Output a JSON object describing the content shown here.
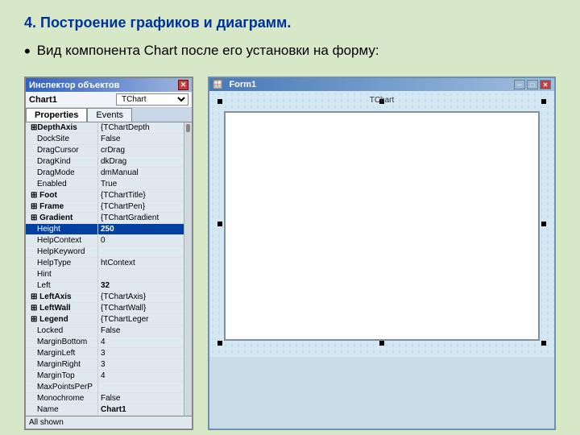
{
  "slide": {
    "title": "4.   Построение графиков и диаграмм.",
    "bullet": "Вид компонента Chart после его установки на форму:"
  },
  "inspector": {
    "title": "Инспектор объектов",
    "close_symbol": "✕",
    "object_name": "Chart1",
    "object_type": "TChart",
    "tabs": [
      "Properties",
      "Events"
    ],
    "active_tab": "Properties",
    "properties": [
      {
        "name": "⊞DepthAxis",
        "value": "{TChartDepth",
        "indent": false,
        "bold_name": true,
        "bold_value": false,
        "group": false,
        "selected": false
      },
      {
        "name": "DockSite",
        "value": "False",
        "indent": true,
        "bold_name": false,
        "bold_value": false,
        "group": false,
        "selected": false
      },
      {
        "name": "DragCursor",
        "value": "crDrag",
        "indent": true,
        "bold_name": false,
        "bold_value": false,
        "group": false,
        "selected": false
      },
      {
        "name": "DragKind",
        "value": "dkDrag",
        "indent": true,
        "bold_name": false,
        "bold_value": false,
        "group": false,
        "selected": false
      },
      {
        "name": "DragMode",
        "value": "dmManual",
        "indent": true,
        "bold_name": false,
        "bold_value": false,
        "group": false,
        "selected": false
      },
      {
        "name": "Enabled",
        "value": "True",
        "indent": true,
        "bold_name": false,
        "bold_value": false,
        "group": false,
        "selected": false
      },
      {
        "name": "⊞ Foot",
        "value": "{TChartTitle}",
        "indent": false,
        "bold_name": true,
        "bold_value": false,
        "group": false,
        "selected": false
      },
      {
        "name": "⊞ Frame",
        "value": "{TChartPen}",
        "indent": false,
        "bold_name": true,
        "bold_value": false,
        "group": false,
        "selected": false
      },
      {
        "name": "⊞ Gradient",
        "value": "{TChartGradient",
        "indent": false,
        "bold_name": true,
        "bold_value": false,
        "group": false,
        "selected": false
      },
      {
        "name": "Height",
        "value": "250",
        "indent": true,
        "bold_name": false,
        "bold_value": true,
        "group": false,
        "selected": true
      },
      {
        "name": "HelpContext",
        "value": "0",
        "indent": true,
        "bold_name": false,
        "bold_value": false,
        "group": false,
        "selected": false
      },
      {
        "name": "HelpKeyword",
        "value": "",
        "indent": true,
        "bold_name": false,
        "bold_value": false,
        "group": false,
        "selected": false
      },
      {
        "name": "HelpType",
        "value": "htContext",
        "indent": true,
        "bold_name": false,
        "bold_value": false,
        "group": false,
        "selected": false
      },
      {
        "name": "Hint",
        "value": "",
        "indent": true,
        "bold_name": false,
        "bold_value": false,
        "group": false,
        "selected": false
      },
      {
        "name": "Left",
        "value": "32",
        "indent": true,
        "bold_name": false,
        "bold_value": true,
        "group": false,
        "selected": false
      },
      {
        "name": "⊞ LeftAxis",
        "value": "{TChartAxis}",
        "indent": false,
        "bold_name": true,
        "bold_value": false,
        "group": false,
        "selected": false
      },
      {
        "name": "⊞ LeftWall",
        "value": "{TChartWall}",
        "indent": false,
        "bold_name": true,
        "bold_value": false,
        "group": false,
        "selected": false
      },
      {
        "name": "⊞ Legend",
        "value": "{TChartLeger",
        "indent": false,
        "bold_name": true,
        "bold_value": false,
        "group": false,
        "selected": false
      },
      {
        "name": "Locked",
        "value": "False",
        "indent": true,
        "bold_name": false,
        "bold_value": false,
        "group": false,
        "selected": false
      },
      {
        "name": "MarginBottom",
        "value": "4",
        "indent": true,
        "bold_name": false,
        "bold_value": false,
        "group": false,
        "selected": false
      },
      {
        "name": "MarginLeft",
        "value": "3",
        "indent": true,
        "bold_name": false,
        "bold_value": false,
        "group": false,
        "selected": false
      },
      {
        "name": "MarginRight",
        "value": "3",
        "indent": true,
        "bold_name": false,
        "bold_value": false,
        "group": false,
        "selected": false
      },
      {
        "name": "MarginTop",
        "value": "4",
        "indent": true,
        "bold_name": false,
        "bold_value": false,
        "group": false,
        "selected": false
      },
      {
        "name": "MaxPointsPerP",
        "value": "",
        "indent": true,
        "bold_name": false,
        "bold_value": false,
        "group": false,
        "selected": false
      },
      {
        "name": "Monochrome",
        "value": "False",
        "indent": true,
        "bold_name": false,
        "bold_value": false,
        "group": false,
        "selected": false
      },
      {
        "name": "Name",
        "value": "Chart1",
        "indent": true,
        "bold_name": false,
        "bold_value": true,
        "group": false,
        "selected": false
      }
    ],
    "footer": "All shown"
  },
  "form": {
    "title": "Form1",
    "title_icon": "🪟",
    "chart_label": "TChart",
    "buttons": [
      "─",
      "□",
      "✕"
    ]
  }
}
